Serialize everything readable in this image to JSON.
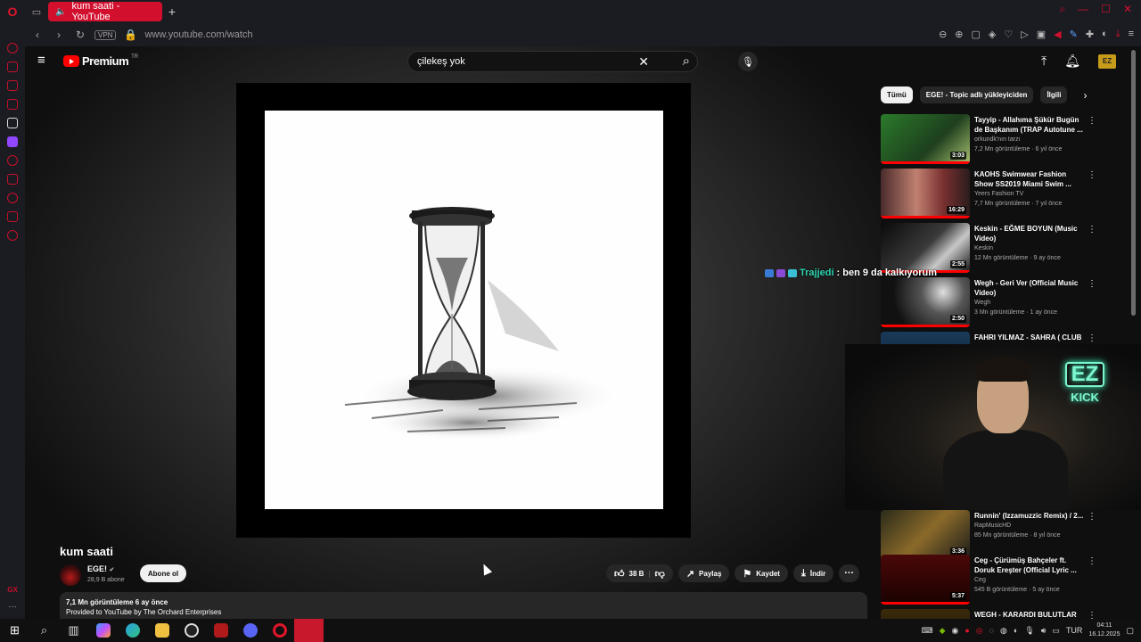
{
  "browser": {
    "tab_title": "kum saati - YouTube",
    "vpn_label": "VPN",
    "url": "www.youtube.com/watch"
  },
  "header": {
    "brand": "Premium",
    "region": "TR",
    "search_value": "çilekeş yok"
  },
  "video": {
    "title": "kum saati",
    "channel": "EGE!",
    "subscribers": "28,9 B abone",
    "subscribe_label": "Abone ol",
    "likes": "38 B",
    "share_label": "Paylaş",
    "save_label": "Kaydet",
    "download_label": "İndir",
    "views_date": "7,1 Mn görüntüleme  6 ay önce",
    "provided_by": "Provided to YouTube by The Orchard Enterprises"
  },
  "chips": [
    "Tümü",
    "EGE! - Topic adlı yükleyiciden",
    "İlgili"
  ],
  "recommendations": [
    {
      "title": "Tayyip - Allahıma Şükür Bugün de Başkanım (TRAP Autotune ...",
      "channel": "orkundk'nın tarzı",
      "meta": "7,2 Mn görüntüleme · 6 yıl önce",
      "duration": "3:03"
    },
    {
      "title": "KAOHS Swimwear Fashion Show SS2019 Miami Swim ...",
      "channel": "Yeers Fashion TV",
      "meta": "7,7 Mn görüntüleme · 7 yıl önce",
      "duration": "16:29"
    },
    {
      "title": "Keskin - EĞME BOYUN (Music Video)",
      "channel": "Keskin",
      "meta": "12 Mn görüntüleme · 9 ay önce",
      "duration": "2:55"
    },
    {
      "title": "Wegh - Geri Ver (Official Music Video)",
      "channel": "Wegh",
      "meta": "3 Mn görüntüleme · 1 ay önce",
      "duration": "2:50"
    },
    {
      "title": "FAHRI YILMAZ - SAHRA ( CLUB",
      "channel": "",
      "meta": "",
      "duration": ""
    },
    {
      "title": "Runnin' (Izzamuzzic Remix) / 2...",
      "channel": "RapMusicHD",
      "meta": "85 Mn görüntüleme · 8 yıl önce",
      "duration": "3:36"
    },
    {
      "title": "Ceg - Çürümüş Bahçeler ft. Doruk Ereşter (Official Lyric ...",
      "channel": "Ceg",
      "meta": "545 B görüntüleme · 5 ay önce",
      "duration": "5:37"
    },
    {
      "title": "WEGH - KARARDI BULUTLAR",
      "channel": "",
      "meta": "",
      "duration": ""
    }
  ],
  "chat": {
    "user": "Trajjedi",
    "message": ": ben 9 da kalkıyorum"
  },
  "webcam": {
    "sign_top": "EZ",
    "sign_bottom": "KICK"
  },
  "taskbar": {
    "language": "TUR",
    "time": "04:11",
    "date": "16.12.2025"
  },
  "colors": {
    "accent_red": "#ff0000",
    "opera_red": "#d2102e",
    "chat_user": "#2fd4b0"
  }
}
